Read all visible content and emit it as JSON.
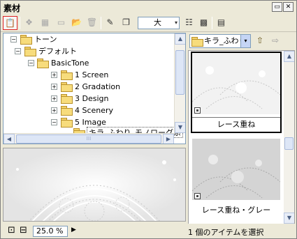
{
  "window": {
    "title": "素材",
    "minimize_glyph": "▭",
    "close_glyph": "✕"
  },
  "toolbar": {
    "size_option": "大",
    "size_select_arrow": "▾",
    "buttons": [
      {
        "name": "paste-material-icon",
        "glyph": "📋"
      },
      {
        "name": "tone-icon",
        "glyph": "❖"
      },
      {
        "name": "grid-icon",
        "glyph": "▦"
      },
      {
        "name": "new-folder-icon",
        "glyph": "▭"
      },
      {
        "name": "open-folder-icon",
        "glyph": "📂"
      },
      {
        "name": "delete-icon",
        "glyph": "🗑"
      },
      {
        "name": "edit-icon",
        "glyph": "✎"
      },
      {
        "name": "copy-icon",
        "glyph": "❐"
      },
      {
        "name": "list-view-icon",
        "glyph": "☷"
      },
      {
        "name": "thumbnail-view-icon",
        "glyph": "▩"
      },
      {
        "name": "panel-menu-icon",
        "glyph": "▤"
      }
    ]
  },
  "tree": {
    "items": [
      {
        "label": "トーン",
        "expander": "−"
      },
      {
        "label": "デフォルト",
        "expander": "−"
      },
      {
        "label": "BasicTone",
        "expander": "−"
      },
      {
        "label": "1 Screen",
        "expander": "+"
      },
      {
        "label": "2 Gradation",
        "expander": "+"
      },
      {
        "label": "3 Design",
        "expander": "+"
      },
      {
        "label": "4 Scenery",
        "expander": "+"
      },
      {
        "label": "5 Image",
        "expander": "−"
      },
      {
        "label": "キラ_ふわり_モノローグ系",
        "expander": ""
      }
    ],
    "scroll_up": "▲",
    "scroll_down": "▼",
    "scroll_left": "◀",
    "scroll_right": "▶",
    "hscroll_grip": "⁞⁞⁞"
  },
  "folder_select": {
    "value": "キラ_ふわり",
    "arrow": "▾"
  },
  "folder_nav": {
    "up_glyph": "⇧",
    "next_glyph": "⇨"
  },
  "thumbnails": [
    {
      "name": "レース重ね",
      "selected": true
    },
    {
      "name": "レース重ね・グレー",
      "selected": false
    }
  ],
  "thumb_scroll": {
    "up": "▲",
    "down": "▼"
  },
  "status": {
    "zoom": "25.0 %",
    "zoom_arrow": "▶",
    "selection_text": "1 個のアイテムを選択",
    "fit_glyph": "⊡",
    "actual_glyph": "⊟"
  }
}
